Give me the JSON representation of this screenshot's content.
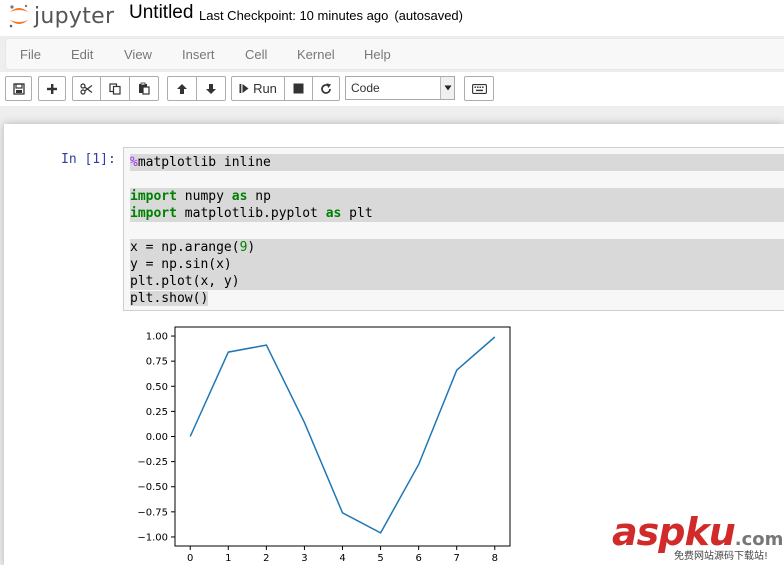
{
  "header": {
    "logo_text": "jupyter",
    "notebook_title": "Untitled",
    "checkpoint_text": "Last Checkpoint: 10 minutes ago",
    "autosave_text": "(autosaved)"
  },
  "menu": [
    "File",
    "Edit",
    "View",
    "Insert",
    "Cell",
    "Kernel",
    "Help"
  ],
  "toolbar": {
    "run_label": "Run",
    "cell_type_value": "Code",
    "icons": [
      "save-icon",
      "plus-icon",
      "cut-icon",
      "copy-icon",
      "paste-icon",
      "arrow-up-icon",
      "arrow-down-icon",
      "step-forward-icon",
      "stop-icon",
      "refresh-icon",
      "keyboard-icon"
    ]
  },
  "cell": {
    "prompt": "In [1]:",
    "code_lines": [
      "%matplotlib inline",
      "",
      "import numpy as np",
      "import matplotlib.pyplot as plt",
      "",
      "x = np.arange(9)",
      "y = np.sin(x)",
      "plt.plot(x, y)",
      "plt.show()"
    ]
  },
  "chart_data": {
    "type": "line",
    "x": [
      0,
      1,
      2,
      3,
      4,
      5,
      6,
      7,
      8
    ],
    "series": [
      {
        "values": [
          0.0,
          0.84,
          0.91,
          0.14,
          -0.76,
          -0.96,
          -0.28,
          0.66,
          0.99
        ],
        "color": "#1f77b4"
      }
    ],
    "xticks": [
      "0",
      "1",
      "2",
      "3",
      "4",
      "5",
      "6",
      "7",
      "8"
    ],
    "yticks": [
      "1.00",
      "0.75",
      "0.50",
      "0.25",
      "0.00",
      "−0.25",
      "−0.50",
      "−0.75",
      "−1.00"
    ],
    "xlim": [
      -0.4,
      8.4
    ],
    "ylim": [
      -1.09,
      1.09
    ],
    "grid": false
  },
  "watermark": {
    "main": "aspku",
    "suffix": ".com",
    "sub": "免费网站源码下载站!"
  }
}
